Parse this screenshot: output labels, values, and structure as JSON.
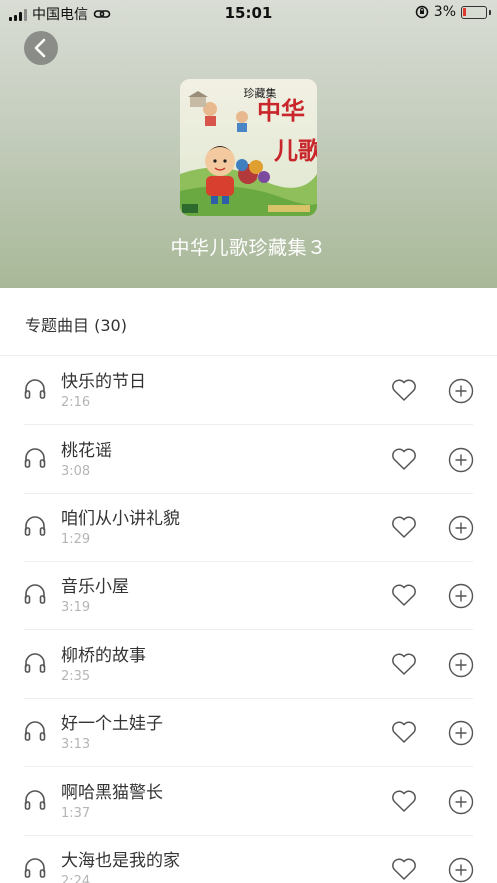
{
  "status_bar": {
    "carrier": "中国电信",
    "time": "15:01",
    "battery": "3%"
  },
  "album": {
    "title": "中华儿歌珍藏集３",
    "cover_title": "中华儿歌",
    "cover_subtitle": "珍藏集"
  },
  "section": {
    "title": "专题曲目 (30)"
  },
  "tracks": [
    {
      "name": "快乐的节日",
      "duration": "2:16"
    },
    {
      "name": "桃花谣",
      "duration": "3:08"
    },
    {
      "name": "咱们从小讲礼貌",
      "duration": "1:29"
    },
    {
      "name": "音乐小屋",
      "duration": "3:19"
    },
    {
      "name": "柳桥的故事",
      "duration": "2:35"
    },
    {
      "name": "好一个土娃子",
      "duration": "3:13"
    },
    {
      "name": "啊哈黑猫警长",
      "duration": "1:37"
    },
    {
      "name": "大海也是我的家",
      "duration": "2:24"
    }
  ],
  "icons": {
    "back": "chevron-left-icon",
    "track": "headphones-icon",
    "favorite": "heart-icon",
    "add": "plus-circle-icon"
  },
  "colors": {
    "header_top": "#d9ddd5",
    "header_bottom": "#a8b897",
    "battery_low": "#e03b30",
    "secondary_text": "#b5b5b5"
  }
}
